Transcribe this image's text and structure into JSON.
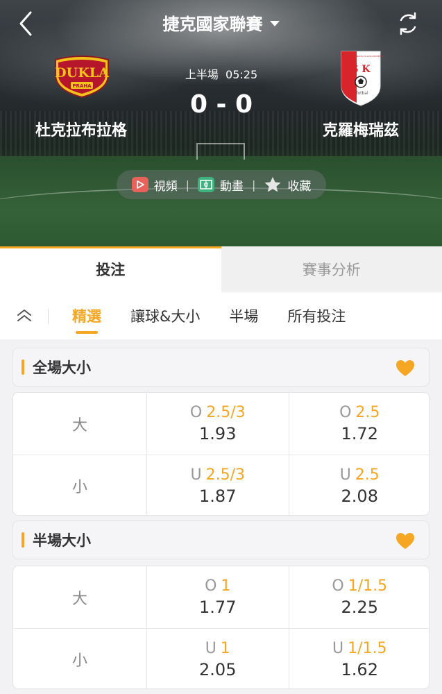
{
  "header": {
    "league_title": "捷克國家聯賽",
    "back_icon": "chevron-left-icon",
    "refresh_icon": "refresh-icon"
  },
  "match": {
    "period": "上半場",
    "clock": "05:25",
    "score": "0 - 0",
    "home": {
      "name": "杜克拉布拉格",
      "logo_text": "DUKLA",
      "logo_sub": "PRAHA"
    },
    "away": {
      "name": "克羅梅瑞茲",
      "logo_top": "HANACKA SLAVIA KROMERIZ",
      "logo_letters": "S K",
      "logo_sub": "fotbal"
    }
  },
  "media": {
    "video_label": "視頻",
    "animation_label": "動畫",
    "favorite_label": "收藏"
  },
  "main_tabs": [
    {
      "label": "投注",
      "active": true
    },
    {
      "label": "賽事分析",
      "active": false
    }
  ],
  "sub_tabs": [
    {
      "label": "精選",
      "active": true
    },
    {
      "label": "讓球&大小",
      "active": false
    },
    {
      "label": "半場",
      "active": false
    },
    {
      "label": "所有投注",
      "active": false
    }
  ],
  "sections": [
    {
      "title": "全場大小",
      "rows": [
        {
          "label": "大",
          "cells": [
            {
              "prefix": "O",
              "line": "2.5/3",
              "price": "1.93"
            },
            {
              "prefix": "O",
              "line": "2.5",
              "price": "1.72"
            }
          ]
        },
        {
          "label": "小",
          "cells": [
            {
              "prefix": "U",
              "line": "2.5/3",
              "price": "1.87"
            },
            {
              "prefix": "U",
              "line": "2.5",
              "price": "2.08"
            }
          ]
        }
      ]
    },
    {
      "title": "半場大小",
      "rows": [
        {
          "label": "大",
          "cells": [
            {
              "prefix": "O",
              "line": "1",
              "price": "1.77"
            },
            {
              "prefix": "O",
              "line": "1/1.5",
              "price": "2.25"
            }
          ]
        },
        {
          "label": "小",
          "cells": [
            {
              "prefix": "U",
              "line": "1",
              "price": "2.05"
            },
            {
              "prefix": "U",
              "line": "1/1.5",
              "price": "1.62"
            }
          ]
        }
      ]
    }
  ],
  "colors": {
    "accent": "#f5a623",
    "away_red": "#d8242b",
    "dukla_yellow": "#f3c21b",
    "dukla_red": "#b5162b"
  }
}
